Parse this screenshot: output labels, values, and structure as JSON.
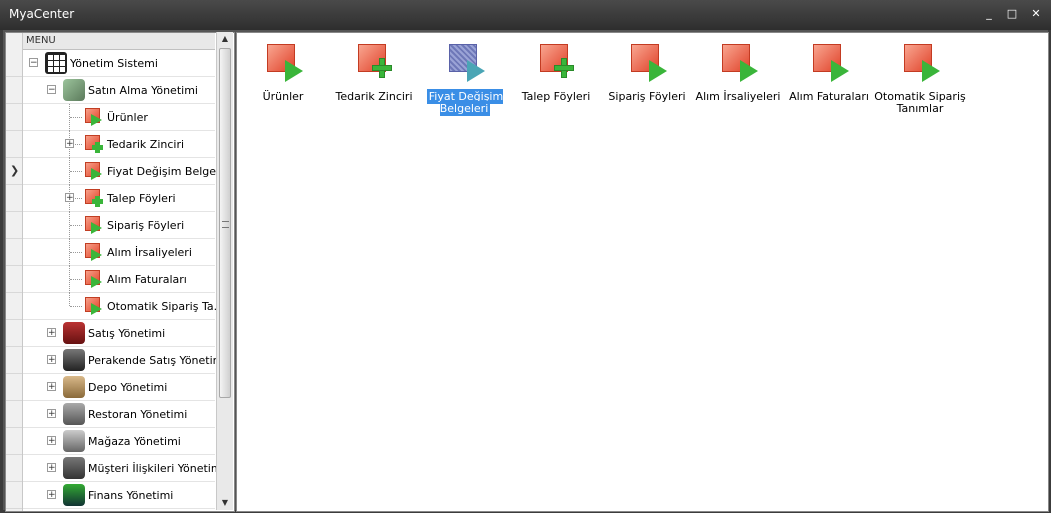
{
  "window": {
    "title": "MyaCenter",
    "minimize": "_",
    "maximize": "□",
    "close": "✕"
  },
  "menu": {
    "header": "MENU",
    "root": "Yönetim Sistemi",
    "purchasing": {
      "label": "Satın Alma Yönetimi",
      "children": [
        {
          "label": "Ürünler",
          "icon": "play"
        },
        {
          "label": "Tedarik Zinciri",
          "icon": "plus"
        },
        {
          "label": "Fiyat Değişim Belgeleri",
          "icon": "play"
        },
        {
          "label": "Talep Föyleri",
          "icon": "plus"
        },
        {
          "label": "Sipariş Föyleri",
          "icon": "play"
        },
        {
          "label": "Alım İrsaliyeleri",
          "icon": "play"
        },
        {
          "label": "Alım Faturaları",
          "icon": "play"
        },
        {
          "label": "Otomatik Sipariş Ta...",
          "icon": "play"
        }
      ]
    },
    "categories": [
      {
        "label": "Satış Yönetimi"
      },
      {
        "label": "Perakende Satış Yönetimi"
      },
      {
        "label": "Depo Yönetimi"
      },
      {
        "label": "Restoran Yönetimi"
      },
      {
        "label": "Mağaza Yönetimi"
      },
      {
        "label": "Müşteri İlişkileri Yönetimi"
      },
      {
        "label": "Finans Yönetimi"
      }
    ]
  },
  "tiles": [
    {
      "label": "Ürünler",
      "icon": "play"
    },
    {
      "label": "Tedarik Zinciri",
      "icon": "plus"
    },
    {
      "label": "Fiyat Değişim Belgeleri",
      "icon": "play",
      "selected": true
    },
    {
      "label": "Talep Föyleri",
      "icon": "plus"
    },
    {
      "label": "Sipariş Föyleri",
      "icon": "play"
    },
    {
      "label": "Alım İrsaliyeleri",
      "icon": "play"
    },
    {
      "label": "Alım Faturaları",
      "icon": "play"
    },
    {
      "label": "Otomatik Sipariş Tanımlar",
      "icon": "play"
    }
  ],
  "colors": {
    "accent": "#3a8ee6",
    "icon_red": "#e2452a",
    "icon_green": "#3ab53a"
  }
}
